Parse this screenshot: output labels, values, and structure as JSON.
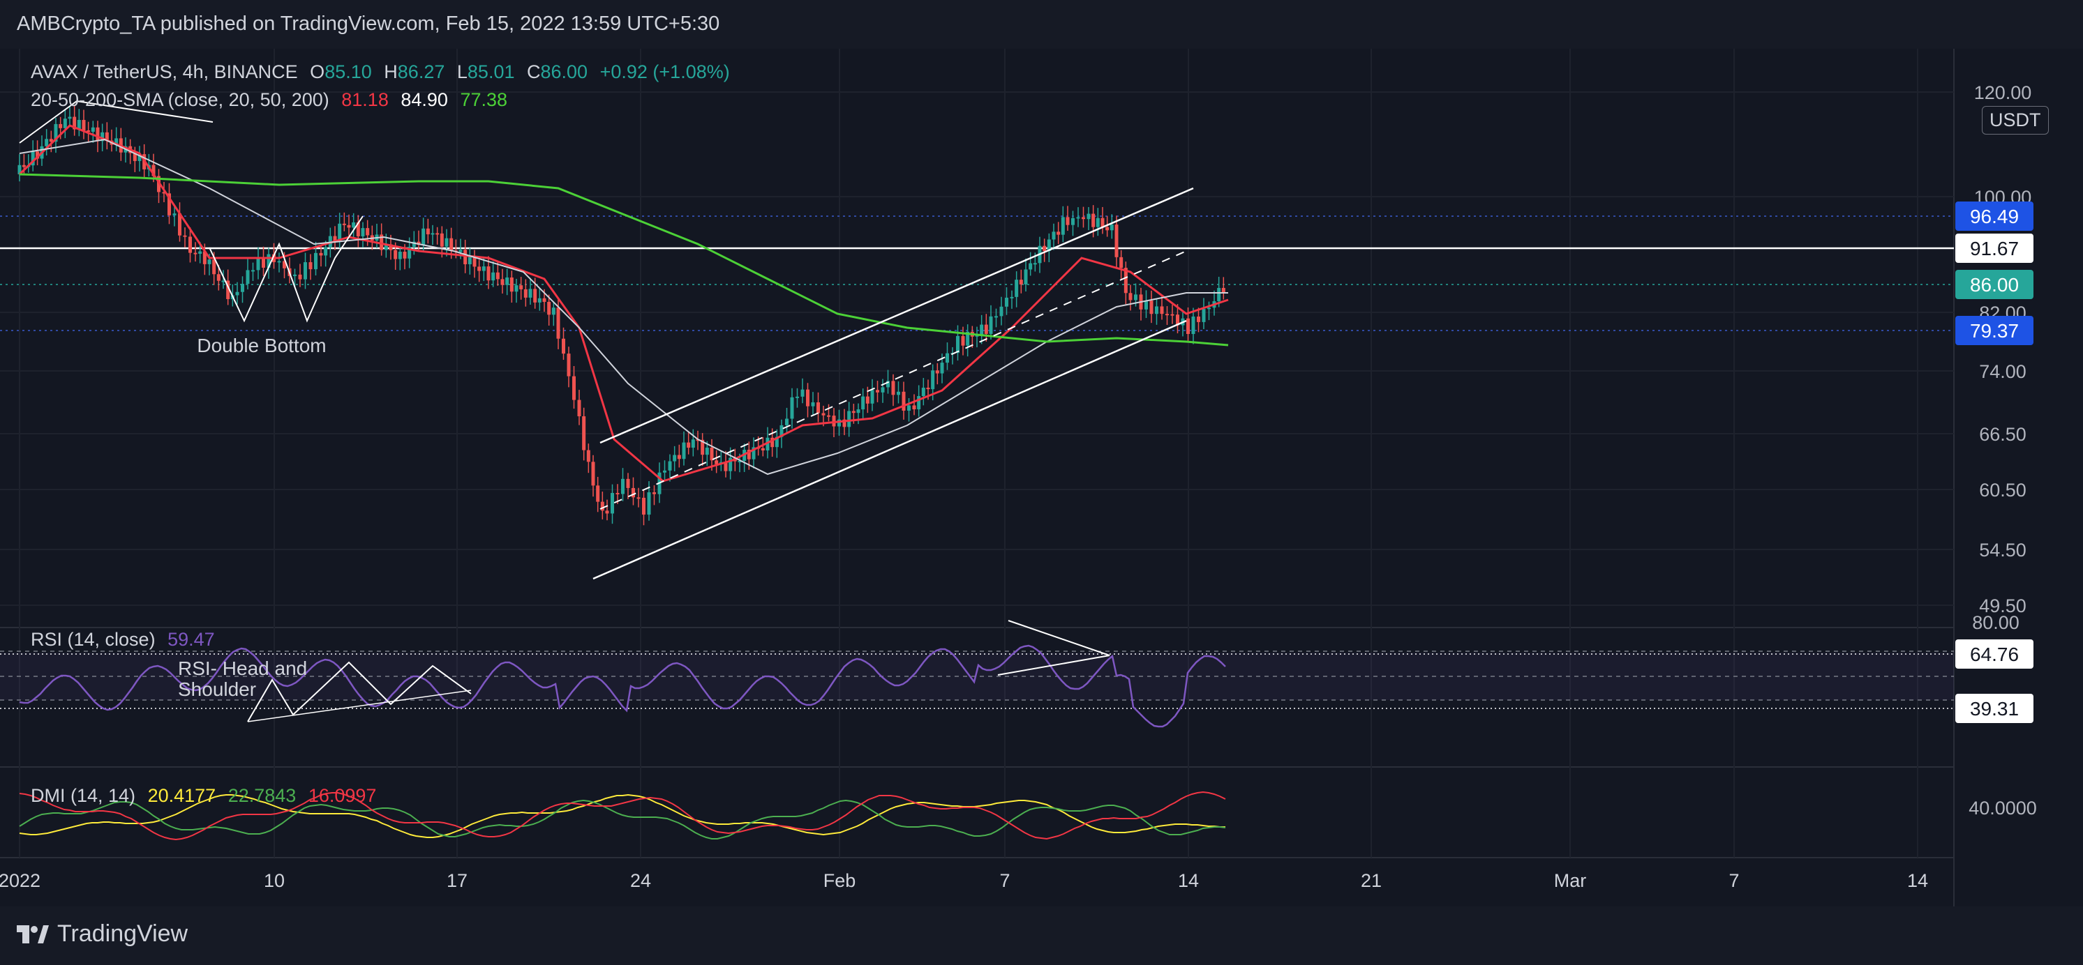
{
  "header": {
    "publisher": "AMBCrypto_TA published on TradingView.com, Feb 15, 2022 13:59 UTC+5:30"
  },
  "symbol": {
    "title": "AVAX / TetherUS, 4h, BINANCE",
    "o_label": "O",
    "o": "85.10",
    "h_label": "H",
    "h": "86.27",
    "l_label": "L",
    "l": "85.01",
    "c_label": "C",
    "c": "86.00",
    "change": "+0.92 (+1.08%)",
    "currency": "USDT"
  },
  "sma": {
    "label": "20-50-200-SMA (close, 20, 50, 200)",
    "v20": "81.18",
    "v50": "84.90",
    "v200": "77.38"
  },
  "price_axis": {
    "ticks": [
      "120.00",
      "100.00",
      "82.00",
      "74.00",
      "66.50",
      "60.50",
      "54.50",
      "49.50"
    ]
  },
  "price_badges": [
    {
      "text": "96.49",
      "color": "#1e53e5"
    },
    {
      "text": "91.67",
      "color": "#ffffff"
    },
    {
      "text": "86.00",
      "color": "#26a69a"
    },
    {
      "text": "79.37",
      "color": "#1e53e5"
    }
  ],
  "rsi": {
    "label": "RSI (14, close)",
    "value": "59.47",
    "axis_top": "80.00",
    "upper": "64.76",
    "lower": "39.31",
    "annotation": "RSI- Head and\nShoulder"
  },
  "dmi": {
    "label": "DMI (14, 14)",
    "adx": "20.4177",
    "plus": "22.7843",
    "minus": "16.0997",
    "axis": "40.0000"
  },
  "annotations": {
    "double_bottom": "Double Bottom"
  },
  "time_axis": {
    "labels": [
      "2022",
      "10",
      "17",
      "24",
      "Feb",
      "7",
      "14",
      "21",
      "Mar",
      "7",
      "14"
    ]
  },
  "footer": {
    "brand": "TradingView"
  },
  "colors": {
    "up": "#26a69a",
    "down": "#ef5350",
    "sma20": "#f23645",
    "sma50": "#d1d4dc",
    "sma200": "#4cd137",
    "rsi": "#7e57c2",
    "adx": "#ffeb3b",
    "plus_di": "#4caf50",
    "minus_di": "#f23645"
  }
}
